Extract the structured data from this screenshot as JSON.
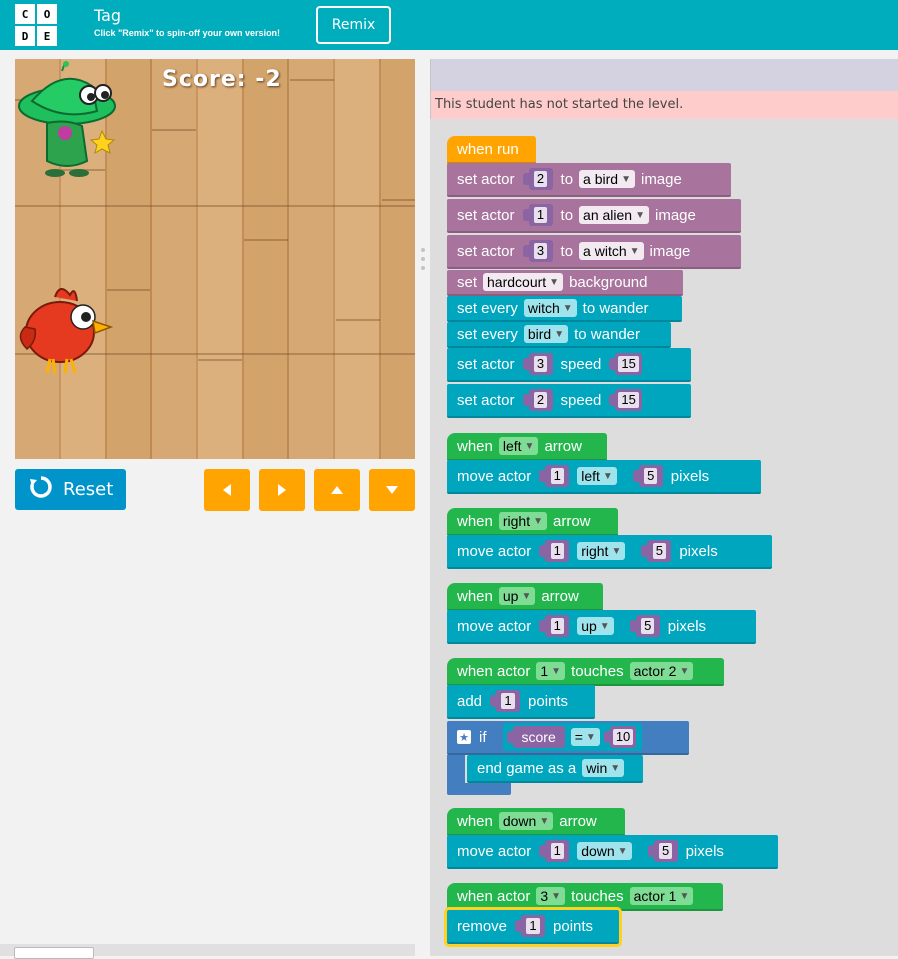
{
  "header": {
    "logo_letters": [
      "C",
      "O",
      "D",
      "E"
    ],
    "title": "Tag",
    "subtitle": "Click \"Remix\" to spin-off your own version!",
    "remix_label": "Remix",
    "bg_color": "#00adbc"
  },
  "stage": {
    "score_text": "Score: -2",
    "background": "hardcourt",
    "actors": [
      "alien",
      "bird"
    ]
  },
  "controls": {
    "reset_label": "Reset",
    "arrows": [
      "left-arrow-icon",
      "right-arrow-icon",
      "up-arrow-icon",
      "down-arrow-icon"
    ],
    "arrow_color": "#ffa400",
    "reset_color": "#0094ca"
  },
  "workspace": {
    "notice": "This student has not started the level.",
    "blocks": {
      "when_run": "when run",
      "set_actor": "set actor",
      "to": "to",
      "image": "image",
      "a_bird": "a bird",
      "an_alien": "an alien",
      "a_witch": "a witch",
      "set": "set",
      "hardcourt": "hardcourt",
      "background": "background",
      "set_every": "set every",
      "witch": "witch",
      "bird": "bird",
      "to_wander": "to wander",
      "speed": "speed",
      "when": "when",
      "arrow": "arrow",
      "left": "left",
      "right": "right",
      "up": "up",
      "down": "down",
      "move_actor": "move actor",
      "pixels": "pixels",
      "when_actor": "when actor",
      "touches": "touches",
      "actor_2": "actor 2",
      "actor_1": "actor 1",
      "add": "add",
      "points": "points",
      "if": "if",
      "score": "score",
      "eq": "=",
      "end_game_as_a": "end game as a",
      "win": "win",
      "remove": "remove",
      "n1": "1",
      "n2": "2",
      "n3": "3",
      "n5": "5",
      "n10": "10",
      "n15": "15"
    }
  }
}
